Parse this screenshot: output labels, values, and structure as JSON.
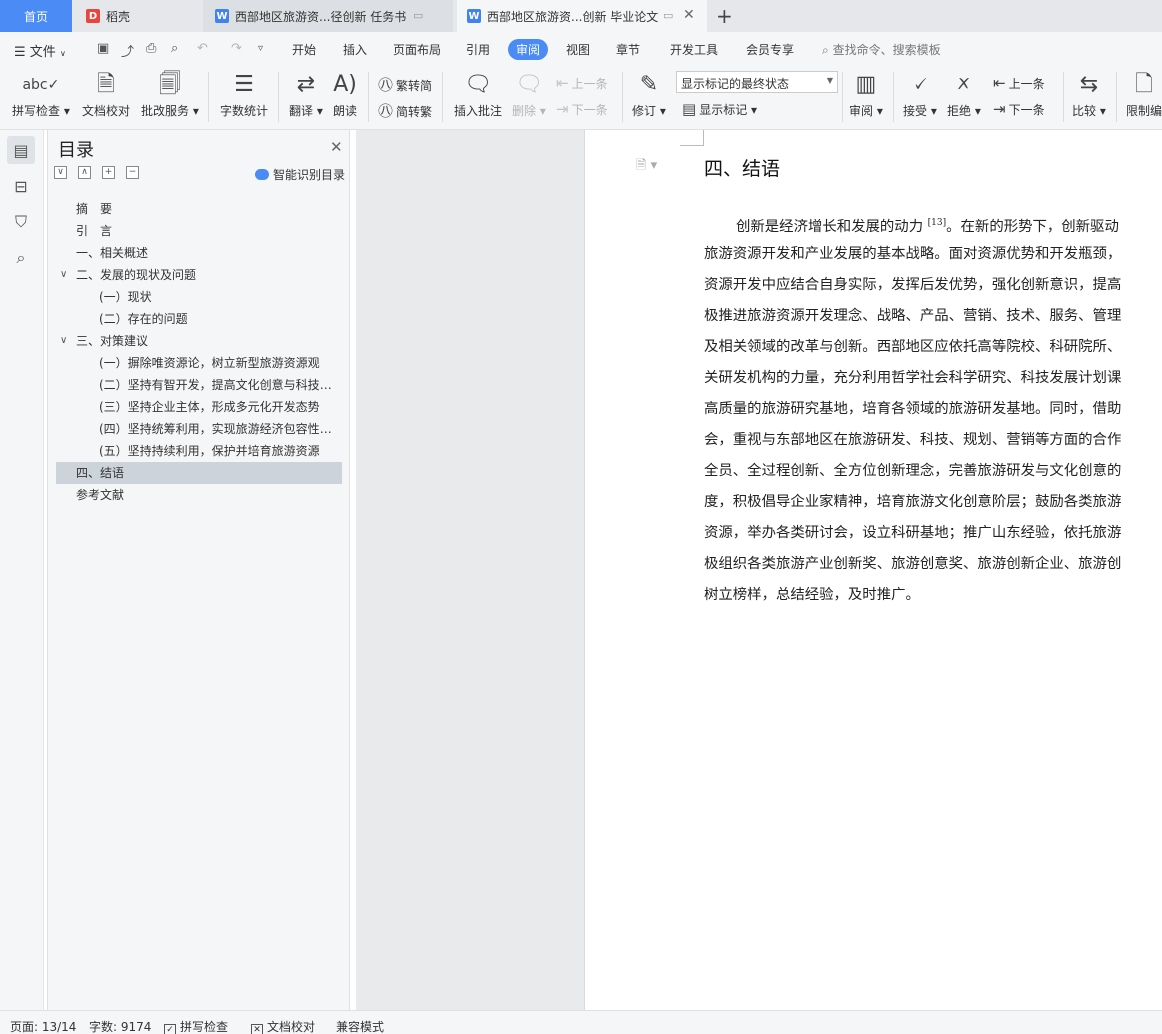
{
  "tabs": {
    "home": "首页",
    "daoke": "稻壳",
    "doc1": "西部地区旅游资...径创新 任务书",
    "doc2": "西部地区旅游资...创新 毕业论文",
    "add": "+"
  },
  "menu": {
    "file": "文件",
    "items": [
      "开始",
      "插入",
      "页面布局",
      "引用",
      "审阅",
      "视图",
      "章节",
      "开发工具",
      "会员专享"
    ],
    "active": "审阅",
    "search": "查找命令、搜索模板"
  },
  "ribbon": {
    "spell_check": "拼写检查",
    "doc_proof": "文档校对",
    "revise_service": "批改服务",
    "word_count": "字数统计",
    "translate": "翻译",
    "read_aloud": "朗读",
    "trad_to_simp": "繁转简",
    "simp_to_trad": "简转繁",
    "insert_comment": "插入批注",
    "delete": "删除",
    "prev_comment": "上一条",
    "next_comment": "下一条",
    "track_changes": "修订",
    "markup_option": "显示标记的最终状态",
    "show_markup": "显示标记",
    "review": "审阅",
    "accept": "接受",
    "reject": "拒绝",
    "prev_change": "上一条",
    "next_change": "下一条",
    "compare": "比较",
    "restrict_edit": "限制编"
  },
  "toc": {
    "title": "目录",
    "smart_toc": "智能识别目录",
    "items": [
      {
        "label": "摘　要",
        "level": 1,
        "chev": ""
      },
      {
        "label": "引　言",
        "level": 1,
        "chev": ""
      },
      {
        "label": "一、相关概述",
        "level": 1,
        "chev": ""
      },
      {
        "label": "二、发展的现状及问题",
        "level": 1,
        "chev": "∨"
      },
      {
        "label": "(一）现状",
        "level": 2,
        "chev": ""
      },
      {
        "label": "(二）存在的问题",
        "level": 2,
        "chev": ""
      },
      {
        "label": "三、对策建议",
        "level": 1,
        "chev": "∨"
      },
      {
        "label": "(一）摒除唯资源论，树立新型旅游资源观",
        "level": 2,
        "chev": ""
      },
      {
        "label": "(二）坚持有智开发，提高文化创意与科技含量",
        "level": 2,
        "chev": ""
      },
      {
        "label": "(三）坚持企业主体，形成多元化开发态势",
        "level": 2,
        "chev": ""
      },
      {
        "label": "(四）坚持统筹利用，实现旅游经济包容性增长",
        "level": 2,
        "chev": ""
      },
      {
        "label": "(五）坚持持续利用，保护并培育旅游资源",
        "level": 2,
        "chev": ""
      },
      {
        "label": "四、结语",
        "level": 1,
        "chev": ""
      },
      {
        "label": "参考文献",
        "level": 1,
        "chev": ""
      }
    ],
    "selected": "四、结语"
  },
  "document": {
    "heading": "四、结语",
    "first_line_pre": "创新是经济增长和发展的动力 ",
    "citation": "[13]",
    "first_line_post": "。在新的形势下，创新驱动",
    "lines": [
      "旅游资源开发和产业发展的基本战略。面对资源优势和开发瓶颈，",
      "资源开发中应结合自身实际，发挥后发优势，强化创新意识，提高",
      "极推进旅游资源开发理念、战略、产品、营销、技术、服务、管理",
      "及相关领域的改革与创新。西部地区应依托高等院校、科研院所、",
      "关研发机构的力量，充分利用哲学社会科学研究、科技发展计划课",
      "高质量的旅游研究基地，培育各领域的旅游研发基地。同时，借助",
      "会，重视与东部地区在旅游研发、科技、规划、营销等方面的合作",
      "全员、全过程创新、全方位创新理念，完善旅游研发与文化创意的",
      "度，积极倡导企业家精神，培育旅游文化创意阶层；鼓励各类旅游",
      "资源，举办各类研讨会，设立科研基地；推广山东经验，依托旅游",
      "极组织各类旅游产业创新奖、旅游创意奖、旅游创新企业、旅游创",
      "树立榜样，总结经验，及时推广。"
    ]
  },
  "status": {
    "page": "页面: 13/14",
    "words": "字数: 9174",
    "spell": "拼写检查",
    "proof": "文档校对",
    "compat": "兼容模式"
  },
  "colors": {
    "accent": "#4a8bf5",
    "selected_row": "#ccd3da"
  }
}
